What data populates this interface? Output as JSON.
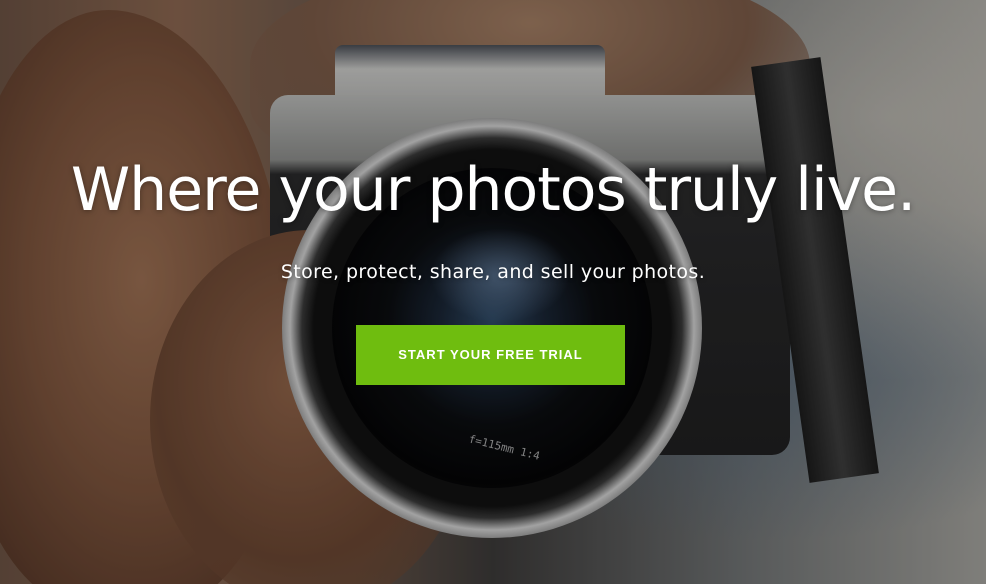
{
  "hero": {
    "headline": "Where your photos truly live.",
    "subheadline": "Store, protect, share, and sell your photos.",
    "cta_label": "START YOUR FREE TRIAL",
    "lens_engraving": "f=115mm  1:4"
  },
  "colors": {
    "cta_background": "#6fbd0f",
    "text": "#ffffff"
  }
}
